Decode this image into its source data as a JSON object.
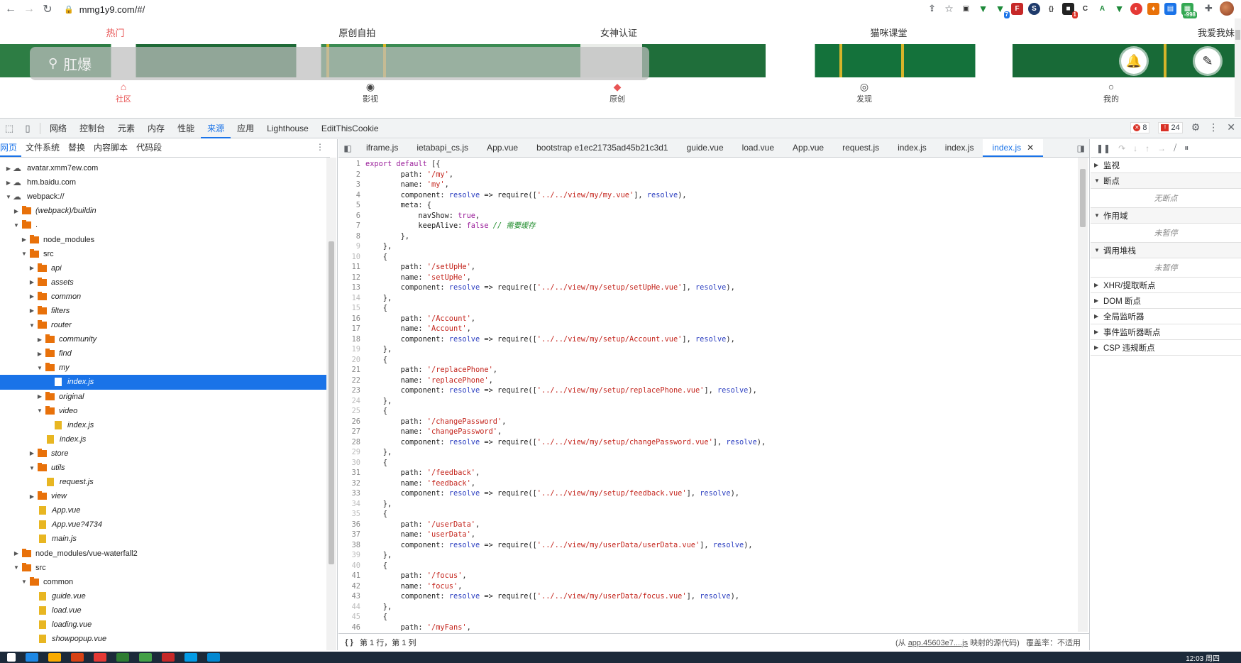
{
  "browser": {
    "url": "mmg1y9.com/#/",
    "extension_badges": [
      "7",
      "1",
      "-998"
    ]
  },
  "page": {
    "categories": [
      "热门",
      "原创自拍",
      "女神认证",
      "猫咪课堂",
      "我爱我妹"
    ],
    "search_placeholder": "肛爆",
    "bottom_nav": [
      {
        "label": "社区",
        "icon": "home-icon"
      },
      {
        "label": "影视",
        "icon": "play-icon"
      },
      {
        "label": "原创",
        "icon": "original-icon"
      },
      {
        "label": "发现",
        "icon": "eye-icon"
      },
      {
        "label": "我的",
        "icon": "user-icon"
      }
    ]
  },
  "devtools": {
    "tabs": [
      "网络",
      "控制台",
      "元素",
      "内存",
      "性能",
      "来源",
      "应用",
      "Lighthouse",
      "EditThisCookie"
    ],
    "active_tab": "来源",
    "error_count": "8",
    "warning_count": "24",
    "navigator_tabs": [
      "网页",
      "文件系统",
      "替换",
      "内容脚本",
      "代码段"
    ],
    "tree": [
      {
        "label": "avatar.xmm7ew.com",
        "type": "cloud",
        "depth": 0,
        "arrow": "▶"
      },
      {
        "label": "hm.baidu.com",
        "type": "cloud",
        "depth": 0,
        "arrow": "▶"
      },
      {
        "label": "webpack://",
        "type": "cloud",
        "depth": 0,
        "arrow": "▼"
      },
      {
        "label": "(webpack)/buildin",
        "type": "folder",
        "depth": 1,
        "arrow": "▶"
      },
      {
        "label": ".",
        "type": "folder",
        "depth": 1,
        "arrow": "▼"
      },
      {
        "label": "node_modules",
        "type": "folder",
        "depth": 2,
        "arrow": "▶"
      },
      {
        "label": "src",
        "type": "folder",
        "depth": 2,
        "arrow": "▼"
      },
      {
        "label": "api",
        "type": "folder",
        "depth": 3,
        "arrow": "▶"
      },
      {
        "label": "assets",
        "type": "folder",
        "depth": 3,
        "arrow": "▶"
      },
      {
        "label": "common",
        "type": "folder",
        "depth": 3,
        "arrow": "▶"
      },
      {
        "label": "filters",
        "type": "folder",
        "depth": 3,
        "arrow": "▶"
      },
      {
        "label": "router",
        "type": "folder",
        "depth": 3,
        "arrow": "▼"
      },
      {
        "label": "community",
        "type": "folder",
        "depth": 4,
        "arrow": "▶"
      },
      {
        "label": "find",
        "type": "folder",
        "depth": 4,
        "arrow": "▶"
      },
      {
        "label": "my",
        "type": "folder",
        "depth": 4,
        "arrow": "▼"
      },
      {
        "label": "index.js",
        "type": "file",
        "depth": 5,
        "arrow": "",
        "selected": true
      },
      {
        "label": "original",
        "type": "folder",
        "depth": 4,
        "arrow": "▶"
      },
      {
        "label": "video",
        "type": "folder",
        "depth": 4,
        "arrow": "▼"
      },
      {
        "label": "index.js",
        "type": "file",
        "depth": 5,
        "arrow": ""
      },
      {
        "label": "index.js",
        "type": "file",
        "depth": 4,
        "arrow": ""
      },
      {
        "label": "store",
        "type": "folder",
        "depth": 3,
        "arrow": "▶"
      },
      {
        "label": "utils",
        "type": "folder",
        "depth": 3,
        "arrow": "▼"
      },
      {
        "label": "request.js",
        "type": "file",
        "depth": 4,
        "arrow": ""
      },
      {
        "label": "view",
        "type": "folder",
        "depth": 3,
        "arrow": "▶"
      },
      {
        "label": "App.vue",
        "type": "file",
        "depth": 3,
        "arrow": ""
      },
      {
        "label": "App.vue?4734",
        "type": "file",
        "depth": 3,
        "arrow": ""
      },
      {
        "label": "main.js",
        "type": "file",
        "depth": 3,
        "arrow": ""
      },
      {
        "label": "node_modules/vue-waterfall2",
        "type": "folder",
        "depth": 1,
        "arrow": "▶"
      },
      {
        "label": "src",
        "type": "folder",
        "depth": 1,
        "arrow": "▼"
      },
      {
        "label": "common",
        "type": "folder",
        "depth": 2,
        "arrow": "▼"
      },
      {
        "label": "guide.vue",
        "type": "file",
        "depth": 3,
        "arrow": ""
      },
      {
        "label": "load.vue",
        "type": "file",
        "depth": 3,
        "arrow": ""
      },
      {
        "label": "loading.vue",
        "type": "file",
        "depth": 3,
        "arrow": ""
      },
      {
        "label": "showpopup.vue",
        "type": "file",
        "depth": 3,
        "arrow": ""
      }
    ],
    "editor_tabs": [
      "iframe.js",
      "ietabapi_cs.js",
      "App.vue",
      "bootstrap e1ec21735ad45b21c3d1",
      "guide.vue",
      "load.vue",
      "App.vue",
      "request.js",
      "index.js",
      "index.js",
      "index.js"
    ],
    "active_editor_tab_index": 10,
    "routes": [
      {
        "path": "/setUpHe",
        "name": "setUpHe",
        "view": "../../view/my/setup/setUpHe.vue"
      },
      {
        "path": "/Account",
        "name": "Account",
        "view": "../../view/my/setup/Account.vue"
      },
      {
        "path": "/replacePhone",
        "name": "replacePhone",
        "view": "../../view/my/setup/replacePhone.vue"
      },
      {
        "path": "/changePassword",
        "name": "changePassword",
        "view": "../../view/my/setup/changePassword.vue"
      },
      {
        "path": "/feedback",
        "name": "feedback",
        "view": "../../view/my/setup/feedback.vue"
      },
      {
        "path": "/userData",
        "name": "userData",
        "view": "../../view/my/userData/userData.vue"
      },
      {
        "path": "/focus",
        "name": "focus",
        "view": "../../view/my/userData/focus.vue"
      }
    ],
    "first_route": {
      "path": "/my",
      "name": "my",
      "view": "../../view/my/my.vue",
      "comment": "// 需要缓存"
    },
    "last_line_path": "/myFans",
    "status": {
      "position": "第 1 行，第 1 列",
      "source_prefix": "(从 ",
      "source_link": "app.45603e7....js",
      "source_suffix": " 映射的源代码)",
      "coverage": "覆盖率：不适用"
    },
    "debugger_sections": [
      {
        "label": "监视",
        "open": false,
        "empty": ""
      },
      {
        "label": "断点",
        "open": true,
        "empty": "无断点"
      },
      {
        "label": "作用域",
        "open": true,
        "empty": "未暂停"
      },
      {
        "label": "调用堆栈",
        "open": true,
        "empty": "未暂停"
      },
      {
        "label": "XHR/提取断点",
        "open": false,
        "empty": ""
      },
      {
        "label": "DOM 断点",
        "open": false,
        "empty": ""
      },
      {
        "label": "全局监听器",
        "open": false,
        "empty": ""
      },
      {
        "label": "事件监听器断点",
        "open": false,
        "empty": ""
      },
      {
        "label": "CSP 违规断点",
        "open": false,
        "empty": ""
      }
    ]
  },
  "taskbar": {
    "clock": "12:03 周四"
  }
}
